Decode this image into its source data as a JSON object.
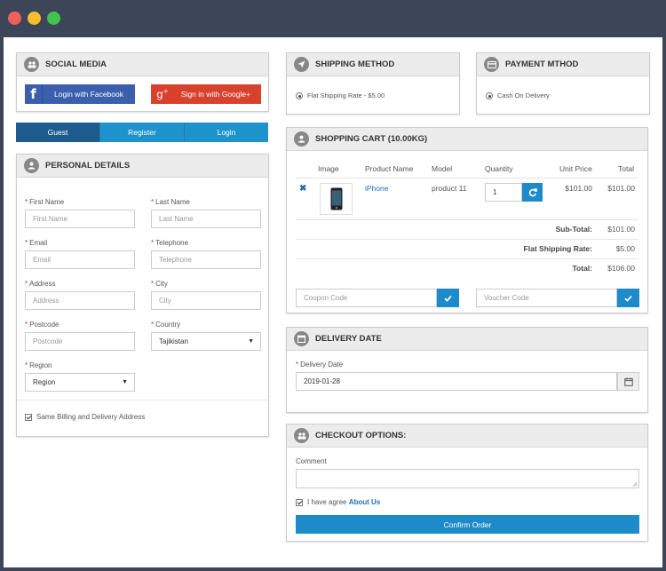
{
  "social": {
    "title": "SOCIAL MEDIA",
    "facebook_label": "Login with Facebook",
    "google_label": "Sign in with Google+"
  },
  "tabs": [
    {
      "label": "Guest"
    },
    {
      "label": "Register"
    },
    {
      "label": "Login"
    }
  ],
  "personal": {
    "title": "PERSONAL DETAILS",
    "first_name": {
      "label": "First Name",
      "placeholder": "First Name"
    },
    "last_name": {
      "label": "Last Name",
      "placeholder": "Last Name"
    },
    "email": {
      "label": "Email",
      "placeholder": "Email"
    },
    "telephone": {
      "label": "Telephone",
      "placeholder": "Telephone"
    },
    "address": {
      "label": "Address",
      "placeholder": "Address"
    },
    "city": {
      "label": "City",
      "placeholder": "City"
    },
    "postcode": {
      "label": "Postcode",
      "placeholder": "Postcode"
    },
    "country": {
      "label": "Country",
      "value": "Tajikistan"
    },
    "region": {
      "label": "Region",
      "value": "Region"
    },
    "same_address_label": "Same Billing and Delivery Address"
  },
  "shipping": {
    "title": "SHIPPING METHOD",
    "option": "Flat Shipping Rate - $5.00"
  },
  "payment": {
    "title": "PAYMENT MTHOD",
    "option": "Cash On Delivery"
  },
  "cart": {
    "title": "SHOPPING CART (10.00KG)",
    "columns": {
      "image": "Image",
      "name": "Product Name",
      "model": "Model",
      "quantity": "Quantity",
      "unit_price": "Unit Price",
      "total": "Total"
    },
    "items": [
      {
        "name": "iPhone",
        "model": "product 11",
        "quantity": "1",
        "unit_price": "$101.00",
        "total": "$101.00"
      }
    ],
    "subtotal_label": "Sub-Total:",
    "subtotal": "$101.00",
    "shipping_label": "Flat Shipping Rate:",
    "shipping": "$5.00",
    "total_label": "Total:",
    "total": "$106.00",
    "coupon_placeholder": "Coupon Code",
    "voucher_placeholder": "Voucher Code"
  },
  "delivery": {
    "title": "DELIVERY DATE",
    "label": "Delivery Date",
    "value": "2019-01-28"
  },
  "checkout": {
    "title": "CHECKOUT OPTIONS:",
    "comment_label": "Comment",
    "agree_text": "I have agree",
    "agree_link": "About Us",
    "confirm_label": "Confirm Order"
  },
  "icons": {
    "accent": "#1d8bc9",
    "active_tab": "#1d5b8f",
    "facebook": "#3b5fad",
    "google": "#d9412f",
    "required": "#e0262b"
  }
}
